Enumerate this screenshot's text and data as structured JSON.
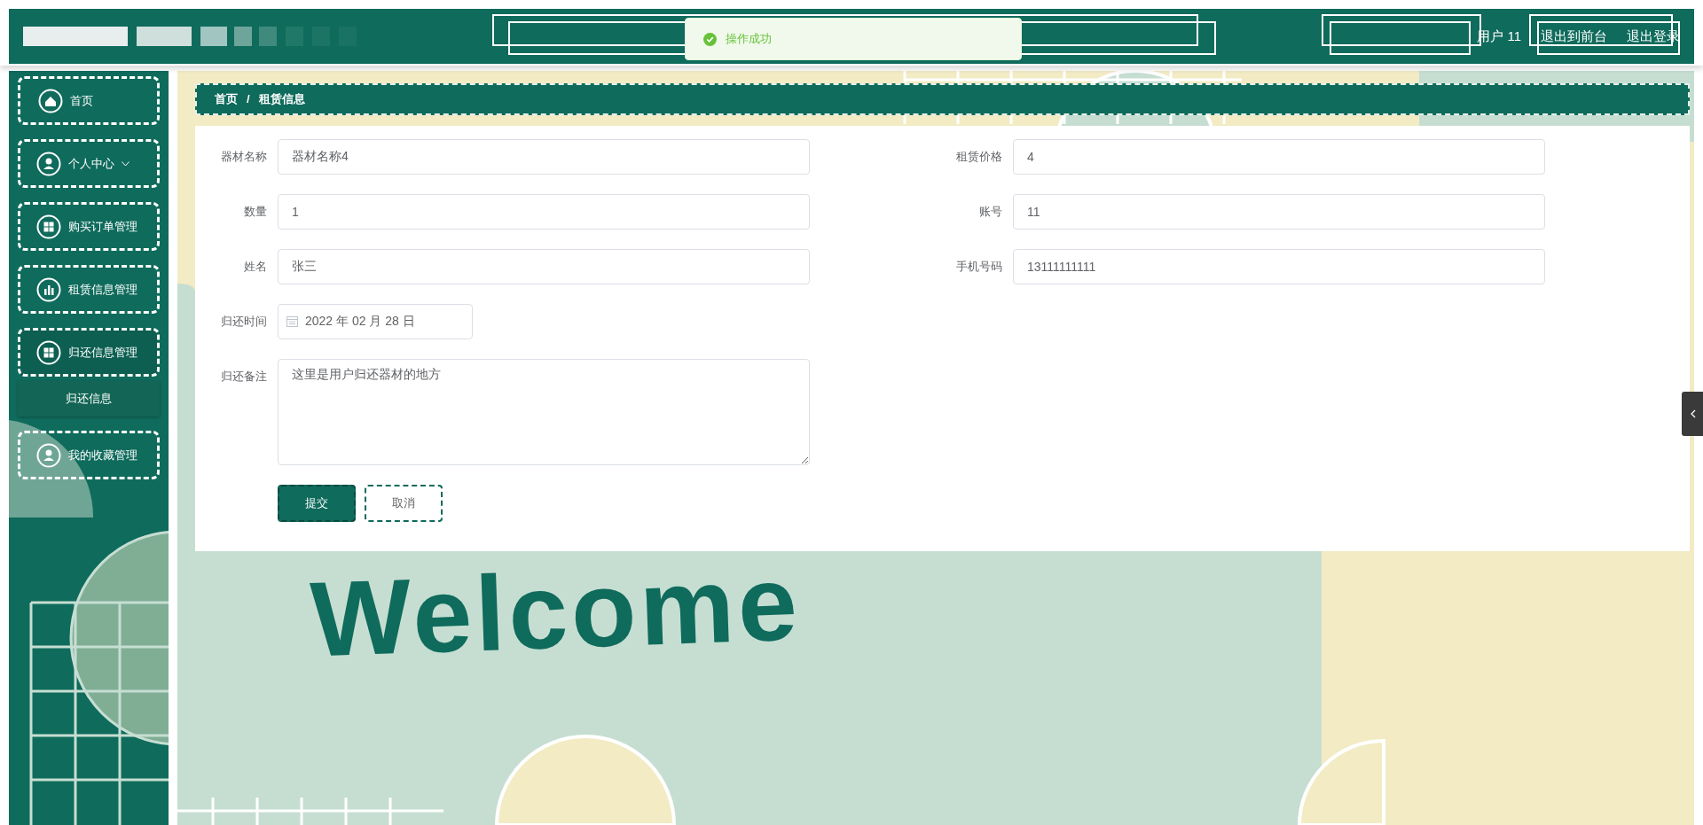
{
  "header": {
    "user": "用户 11",
    "links": [
      "退出到前台",
      "退出登录"
    ]
  },
  "toast": {
    "kind": "success",
    "message": "操作成功"
  },
  "sidebar": {
    "items": [
      {
        "label": "首页",
        "caret": false,
        "expanded": false
      },
      {
        "label": "个人中心",
        "caret": true,
        "expanded": false
      },
      {
        "label": "购买订单管理",
        "caret": false,
        "expanded": false
      },
      {
        "label": "租赁信息管理",
        "caret": false,
        "expanded": false
      },
      {
        "label": "归还信息管理",
        "caret": false,
        "expanded": true,
        "children": [
          {
            "label": "归还信息"
          }
        ]
      },
      {
        "label": "我的收藏管理",
        "caret": false,
        "expanded": false
      }
    ]
  },
  "breadcrumb": {
    "items": [
      "首页",
      "租赁信息"
    ],
    "separator": "/"
  },
  "form": {
    "rows": [
      [
        {
          "label": "器材名称",
          "kind": "text",
          "value": "器材名称4"
        },
        {
          "label": "租赁价格",
          "kind": "text",
          "value": "4"
        }
      ],
      [
        {
          "label": "数量",
          "kind": "text",
          "value": "1"
        },
        {
          "label": "账号",
          "kind": "text",
          "value": "11"
        }
      ],
      [
        {
          "label": "姓名",
          "kind": "text",
          "value": "张三"
        },
        {
          "label": "手机号码",
          "kind": "text",
          "value": "13111111111"
        }
      ],
      [
        {
          "label": "归还时间",
          "kind": "date",
          "value": "2022 年 02 月 28 日"
        }
      ],
      [
        {
          "label": "归还备注",
          "kind": "textarea",
          "value": "这里是用户归还器材的地方"
        }
      ]
    ],
    "buttons": [
      {
        "label": "提交",
        "kind": "primary"
      },
      {
        "label": "取消",
        "kind": "plain"
      }
    ]
  },
  "welcome_text": "Welcome"
}
